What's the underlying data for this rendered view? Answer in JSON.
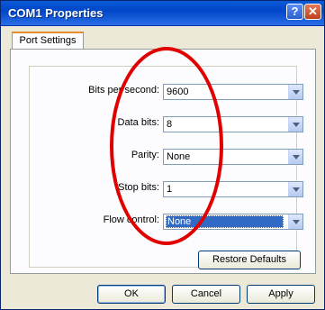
{
  "window": {
    "title": "COM1 Properties"
  },
  "title_buttons": {
    "help": "?",
    "close": "✕"
  },
  "tabs": [
    {
      "label": "Port Settings",
      "active": true
    }
  ],
  "fields": [
    {
      "label": "Bits per second:",
      "value": "9600"
    },
    {
      "label": "Data bits:",
      "value": "8"
    },
    {
      "label": "Parity:",
      "value": "None"
    },
    {
      "label": "Stop bits:",
      "value": "1"
    },
    {
      "label": "Flow control:",
      "value": "None",
      "focused": true
    }
  ],
  "restore_defaults_label": "Restore Defaults",
  "footer": {
    "ok_label": "OK",
    "cancel_label": "Cancel",
    "apply_label": "Apply"
  },
  "colors": {
    "titlebar": "#0046c8",
    "tab_highlight": "#e68b2c",
    "selection": "#316ac5",
    "annotation": "#e00000"
  },
  "icons": {
    "dropdown": "chevron-down-icon"
  }
}
